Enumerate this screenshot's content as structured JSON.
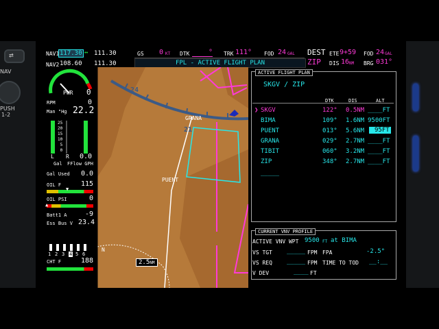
{
  "bezel": {
    "nav_label": "NAV",
    "push_label": "PUSH",
    "push_sub": "1-2"
  },
  "nav": {
    "nav1_label": "NAV1",
    "nav1_active": "117.30",
    "nav1_arrow": "↔",
    "nav1_standby": "111.30",
    "nav2_label": "NAV2",
    "nav2_active": "108.60",
    "nav2_standby": "111.30"
  },
  "top_bar": {
    "gs_label": "GS",
    "gs_value": "0",
    "gs_unit": "KT",
    "dtk_label": "DTK",
    "dtk_value": "°",
    "trk_label": "TRK",
    "trk_value": "111°",
    "fod_label": "FOD",
    "fod_value": "24",
    "fod_unit": "GAL",
    "dest_label": "DEST",
    "ete_label": "ETE",
    "ete_value": "9+59",
    "fod2_label": "FOD",
    "fod2_value": "24",
    "fod2_unit": "GAL",
    "dest_value": "ZIP",
    "dis_label": "DIS",
    "dis_value": "16",
    "dis_unit": "NM",
    "brg_label": "BRG",
    "brg_value": "031°",
    "page_title": "FPL - ACTIVE FLIGHT PLAN"
  },
  "eis": {
    "pwr_label": "PWR",
    "pwr_value": "0",
    "rpm_label": "RPM",
    "rpm_value": "0",
    "man_label": "Man \"Hg",
    "man_value": "22.2",
    "ff_l": "L",
    "ff_r": "R",
    "ff_value": "0.0",
    "gal_label": "Gal",
    "ff_label": "FFlow GPH",
    "gal_used_label": "Gal Used",
    "gal_used_value": "0.0",
    "oil_f_label": "OIL F",
    "oil_f_value": "115",
    "oil_psi_label": "OIL PSI",
    "oil_psi_value": "0",
    "batt_label": "Batt1 A",
    "batt_value": "-9",
    "ess_label": "Ess Bus V",
    "ess_value": "23.4",
    "cyl_numbers": [
      "1",
      "2",
      "3",
      "4",
      "5",
      "6"
    ],
    "cht_label": "CHT F",
    "cht_value": "188",
    "fuel_ticks": [
      "25",
      "20",
      "15",
      "10",
      "5",
      "0"
    ]
  },
  "map": {
    "range_label": "2.5",
    "range_unit": "NM",
    "wpt_grana": "GRANA",
    "wpt_puent": "PUENT",
    "north_label": "N",
    "hdg_24": "24",
    "hdg_21": "21"
  },
  "fpl": {
    "header": "ACTIVE FLIGHT PLAN",
    "route": "SKGV / ZIP",
    "col_dtk": "DTK",
    "col_dis": "DIS",
    "col_alt": "ALT",
    "rows": [
      {
        "wpt": "SKGV",
        "dtk": "122°",
        "dis": "0.5NM",
        "alt": "____FT",
        "active": true
      },
      {
        "wpt": "BIMA",
        "dtk": "109°",
        "dis": "1.6NM",
        "alt": "9500FT",
        "active": false
      },
      {
        "wpt": "PUENT",
        "dtk": "013°",
        "dis": "5.6NM",
        "alt": "95FT",
        "active": false
      },
      {
        "wpt": "GRANA",
        "dtk": "029°",
        "dis": "2.7NM",
        "alt": "____FT",
        "active": false
      },
      {
        "wpt": "TIBIT",
        "dtk": "060°",
        "dis": "3.2NM",
        "alt": "____FT",
        "active": false
      },
      {
        "wpt": "ZIP",
        "dtk": "348°",
        "dis": "2.7NM",
        "alt": "____FT",
        "active": false
      }
    ],
    "empty_row": "_____"
  },
  "vnv": {
    "header": "CURRENT VNV PROFILE",
    "active_label": "ACTIVE VNV WPT",
    "active_alt": "9500",
    "active_unit": "FT",
    "active_at": "at BIMA",
    "vs_tgt_label": "VS TGT",
    "vs_tgt_value": "_____",
    "vs_tgt_unit": "FPM",
    "fpa_label": "FPA",
    "fpa_value": "-2.5°",
    "vs_req_label": "VS REQ",
    "vs_req_value": "_____",
    "vs_req_unit": "FPM",
    "tod_label": "TIME TO TOD",
    "tod_value": "__:__",
    "vdev_label": "V DEV",
    "vdev_value": "____",
    "vdev_unit": "FT"
  },
  "colors": {
    "cyan": "#27e7ea",
    "magenta": "#ff3ad8",
    "green": "#22e33c",
    "terrain": "#b67a3a",
    "ground": "#a6692f"
  }
}
